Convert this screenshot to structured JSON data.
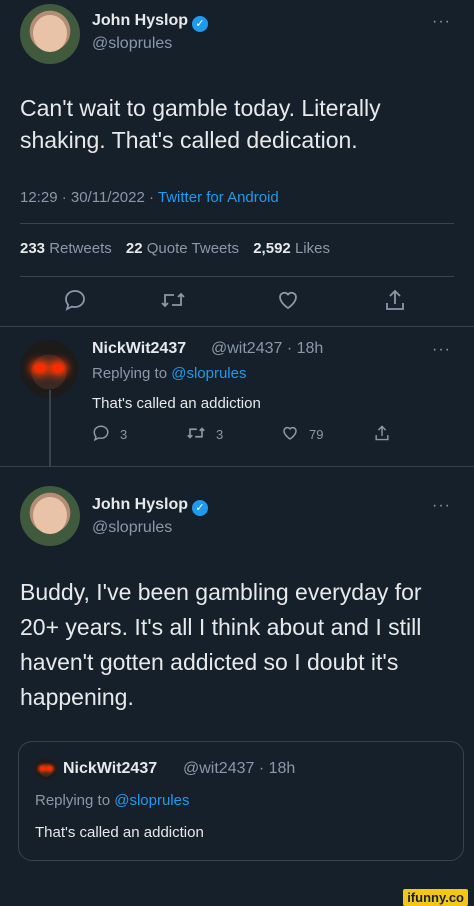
{
  "tweet": {
    "author_name": "John Hyslop",
    "author_handle": "@sloprules",
    "text": "Can't wait to gamble today. Literally shaking. That's called dedication.",
    "timestamp": "12:29 · 30/11/2022 · ",
    "source": "Twitter for Android",
    "stats": {
      "retweets_count": "233",
      "retweets_label": "Retweets",
      "quotes_count": "22",
      "quotes_label": "Quote Tweets",
      "likes_count": "2,592",
      "likes_label": "Likes"
    }
  },
  "reply": {
    "author_name": "NickWit2437",
    "author_handle_time": "@wit2437 · 18h",
    "replying_to_label": "Replying to ",
    "replying_to_handle": "@sloprules",
    "text": "That's called an addiction",
    "reply_count": "3",
    "retweet_count": "3",
    "like_count": "79"
  },
  "quote_tweet": {
    "author_name": "John Hyslop",
    "author_handle": "@sloprules",
    "text": "Buddy, I've been gambling everyday for 20+ years. It's all I think about and I still haven't gotten addicted so I doubt it's happening.",
    "quoted": {
      "author_name": "NickWit2437",
      "author_handle_time": "@wit2437 · 18h",
      "replying_to_label": "Replying to ",
      "replying_to_handle": "@sloprules",
      "text": "That's called an addiction"
    }
  },
  "watermark": "ifunny.co",
  "colors": {
    "background": "#15202b",
    "accent": "#1d9bf0",
    "muted": "#8b98a5",
    "text": "#e7e9ea"
  }
}
